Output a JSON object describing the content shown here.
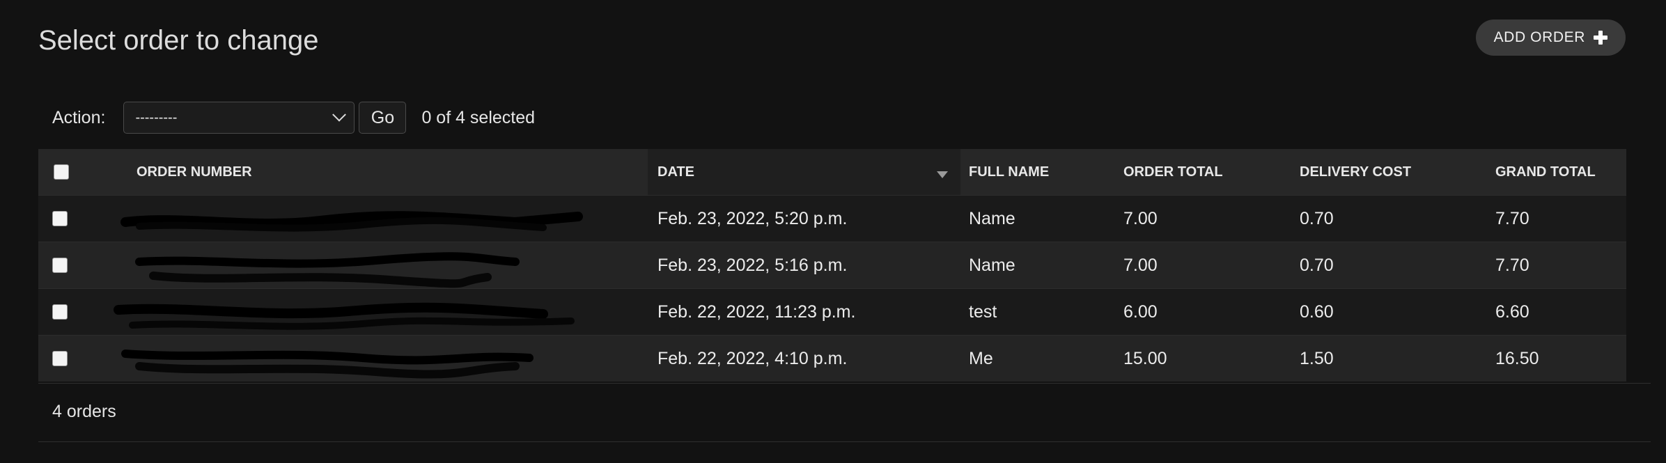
{
  "header": {
    "title": "Select order to change",
    "add_button_label": "ADD ORDER"
  },
  "actions": {
    "label": "Action:",
    "selected_option": "---------",
    "go_label": "Go",
    "selection_status": "0 of 4 selected"
  },
  "table": {
    "columns": [
      "ORDER NUMBER",
      "DATE",
      "FULL NAME",
      "ORDER TOTAL",
      "DELIVERY COST",
      "GRAND TOTAL"
    ],
    "sorted_column": "DATE",
    "rows": [
      {
        "order_number": "",
        "date": "Feb. 23, 2022, 5:20 p.m.",
        "full_name": "Name",
        "order_total": "7.00",
        "delivery_cost": "0.70",
        "grand_total": "7.70"
      },
      {
        "order_number": "",
        "date": "Feb. 23, 2022, 5:16 p.m.",
        "full_name": "Name",
        "order_total": "7.00",
        "delivery_cost": "0.70",
        "grand_total": "7.70"
      },
      {
        "order_number": "",
        "date": "Feb. 22, 2022, 11:23 p.m.",
        "full_name": "test",
        "order_total": "6.00",
        "delivery_cost": "0.60",
        "grand_total": "6.60"
      },
      {
        "order_number": "",
        "date": "Feb. 22, 2022, 4:10 p.m.",
        "full_name": "Me",
        "order_total": "15.00",
        "delivery_cost": "1.50",
        "grand_total": "16.50"
      }
    ]
  },
  "footer": {
    "result_count": "4 orders"
  },
  "colors": {
    "background": "#121212",
    "header_row": "#272727",
    "link": "#4fa6e0",
    "add_button": "#3a3a3a"
  }
}
